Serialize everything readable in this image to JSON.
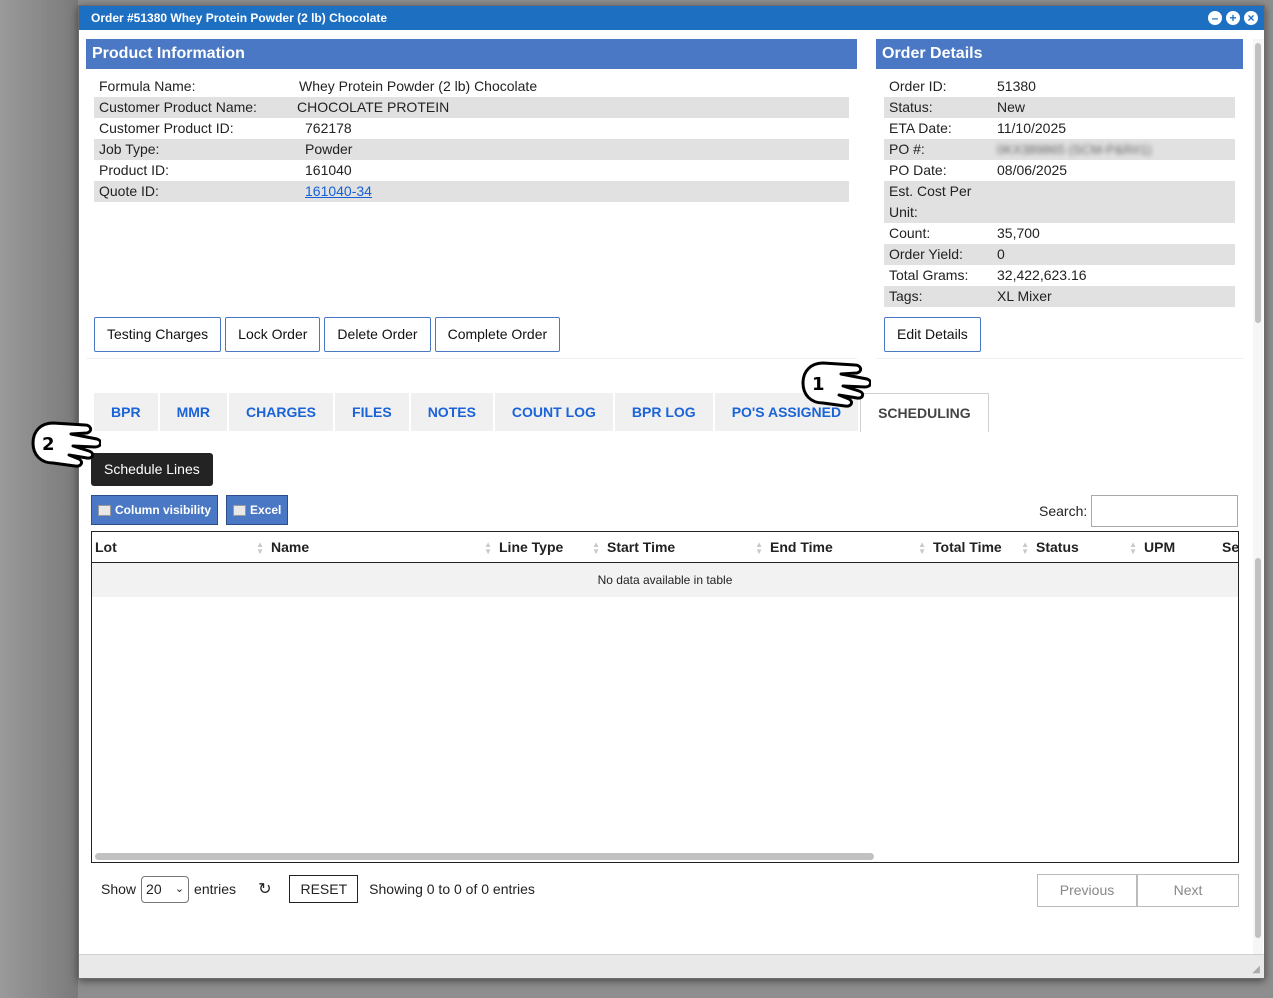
{
  "window": {
    "title": "Order #51380  Whey Protein Powder (2 lb) Chocolate",
    "controls": [
      "minimize-icon",
      "maximize-icon",
      "close-icon"
    ]
  },
  "product_info": {
    "heading": "Product Information",
    "rows": [
      {
        "label": "Formula Name:",
        "value": "Whey Protein Powder (2 lb) Chocolate"
      },
      {
        "label": "Customer Product Name:",
        "value": "CHOCOLATE PROTEIN"
      },
      {
        "label": "Customer Product ID:",
        "value": "762178"
      },
      {
        "label": "Job Type:",
        "value": "Powder"
      },
      {
        "label": "Product ID:",
        "value": "161040"
      },
      {
        "label": "Quote ID:",
        "value": "161040-34"
      }
    ],
    "buttons": {
      "testing": "Testing Charges",
      "lock": "Lock Order",
      "delete": "Delete Order",
      "complete": "Complete Order"
    }
  },
  "order_details": {
    "heading": "Order Details",
    "rows": [
      {
        "label": "Order ID:",
        "value": "51380"
      },
      {
        "label": "Status:",
        "value": "New"
      },
      {
        "label": "ETA Date:",
        "value": "11/10/2025"
      },
      {
        "label": "PO #:",
        "value": "0KX389865 (SCM-P&R#1)"
      },
      {
        "label": "PO Date:",
        "value": "08/06/2025"
      },
      {
        "label": "Est. Cost Per Unit:",
        "value": ""
      },
      {
        "label": "Count:",
        "value": "35,700"
      },
      {
        "label": "Order Yield:",
        "value": "0"
      },
      {
        "label": "Total Grams:",
        "value": "32,422,623.16"
      },
      {
        "label": "Tags:",
        "value": "XL Mixer"
      }
    ],
    "edit_button": "Edit Details"
  },
  "tabs": [
    "BPR",
    "MMR",
    "CHARGES",
    "FILES",
    "NOTES",
    "COUNT LOG",
    "BPR LOG",
    "PO'S ASSIGNED",
    "SCHEDULING"
  ],
  "active_tab": "SCHEDULING",
  "tooltip": "Schedule Lines",
  "table_tools": {
    "column_visibility": "Column visibility",
    "excel": "Excel",
    "search_label": "Search:",
    "search_value": ""
  },
  "table": {
    "columns": [
      "Lot",
      "Name",
      "Line Type",
      "Start Time",
      "End Time",
      "Total Time",
      "Status",
      "UPM",
      "Se"
    ],
    "empty_message": "No data available in table"
  },
  "footer": {
    "show_label": "Show",
    "entries_value": "20",
    "entries_label": "entries",
    "reset_label": "RESET",
    "showing_text": "Showing 0 to 0 of 0 entries",
    "previous_label": "Previous",
    "next_label": "Next"
  },
  "annotations": {
    "hand_1": "1",
    "hand_2": "2"
  },
  "colors": {
    "title_bar": "#1d6fc2",
    "panel_header": "#4a78c4",
    "tab_text": "#1a63d8"
  }
}
